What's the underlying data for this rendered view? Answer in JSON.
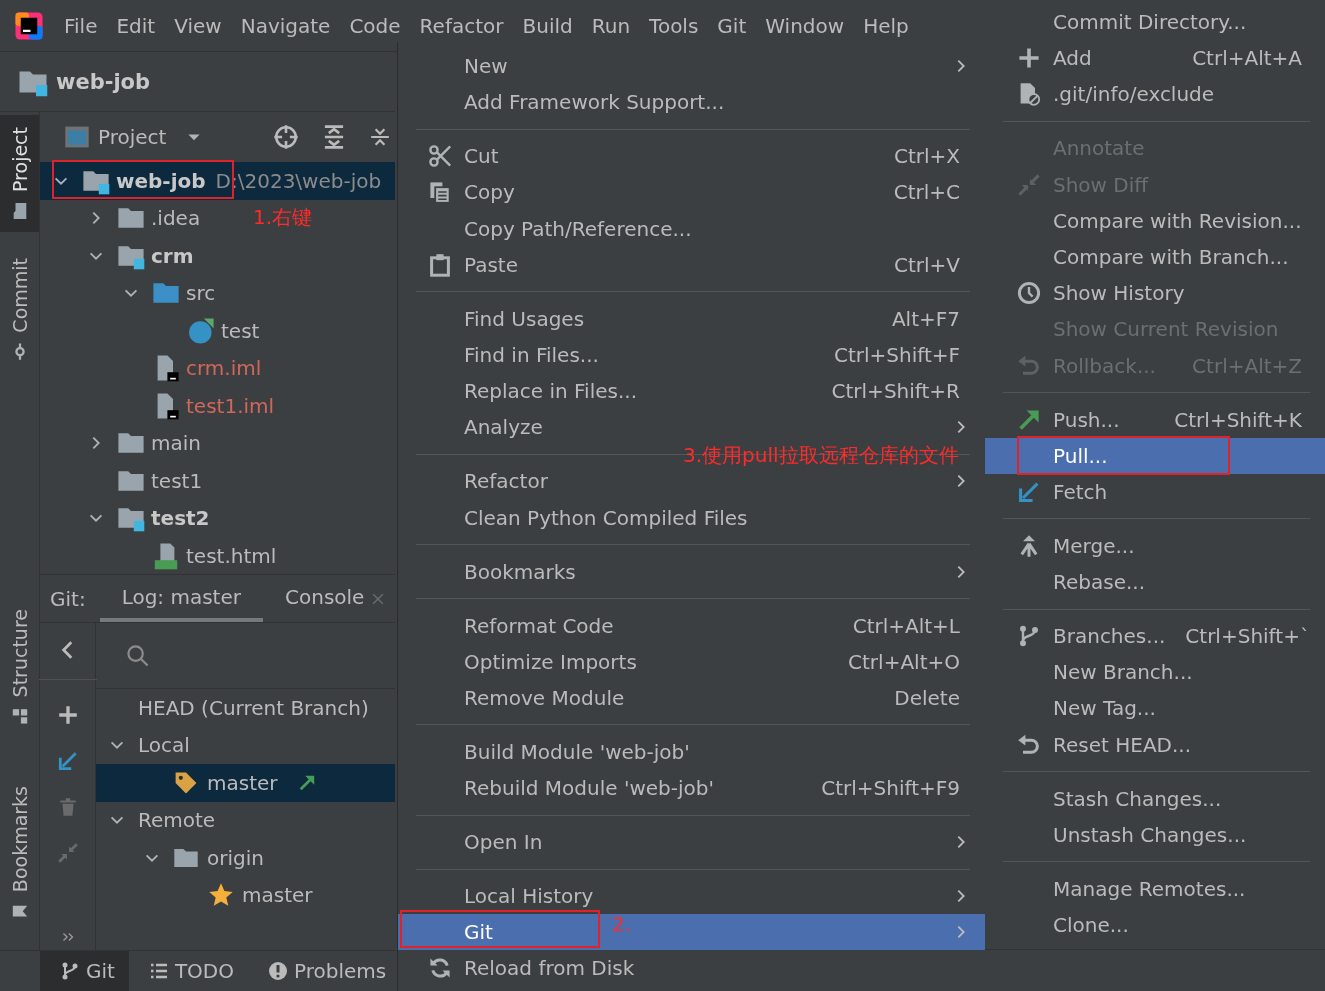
{
  "menubar": {
    "items": [
      "File",
      "Edit",
      "View",
      "Navigate",
      "Code",
      "Refactor",
      "Build",
      "Run",
      "Tools",
      "Git",
      "Window",
      "Help"
    ]
  },
  "navbar": {
    "project": "web-job"
  },
  "tool_strip": {
    "top": [
      {
        "label": "Project",
        "kind": "folder",
        "selected": true
      },
      {
        "label": "Commit",
        "kind": "commit",
        "selected": false
      }
    ],
    "bottom": [
      {
        "label": "Structure",
        "kind": "structure",
        "selected": false
      },
      {
        "label": "Bookmarks",
        "kind": "bookmark",
        "selected": false
      }
    ]
  },
  "project_panel": {
    "title": "Project",
    "tree": [
      {
        "label": "web-job",
        "path": "D:\\2023\\web-job",
        "kind": "module",
        "bold": true,
        "expanded": true,
        "selected": true,
        "children": [
          {
            "label": ".idea",
            "kind": "folder",
            "expanded": false,
            "selected": false
          },
          {
            "label": "crm",
            "kind": "module",
            "bold": true,
            "expanded": true,
            "selected": false,
            "children": [
              {
                "label": "src",
                "kind": "source",
                "expanded": true,
                "selected": false,
                "children": [
                  {
                    "label": "test",
                    "kind": "class",
                    "selected": false
                  }
                ]
              },
              {
                "label": "crm.iml",
                "kind": "iml",
                "color": "#d1675a",
                "selected": false
              },
              {
                "label": "test1.iml",
                "kind": "iml",
                "color": "#d1675a",
                "selected": false
              }
            ]
          },
          {
            "label": "main",
            "kind": "folder",
            "expanded": false,
            "selected": false
          },
          {
            "label": "test1",
            "kind": "folder",
            "selected": false
          },
          {
            "label": "test2",
            "kind": "module",
            "bold": true,
            "expanded": true,
            "selected": false,
            "children": [
              {
                "label": "test.html",
                "kind": "html",
                "selected": false
              }
            ]
          }
        ]
      }
    ]
  },
  "git_panel": {
    "label": "Git:",
    "tabs": [
      {
        "label": "Log: master",
        "selected": true
      },
      {
        "label": "Console",
        "selected": false,
        "closable": true
      }
    ],
    "toolbar": [
      {
        "kind": "back",
        "disabled": false
      },
      {
        "kind": "plus",
        "disabled": false
      },
      {
        "kind": "fetch",
        "disabled": false
      },
      {
        "kind": "trash",
        "disabled": true
      },
      {
        "kind": "compress",
        "disabled": true
      },
      {
        "kind": "more",
        "disabled": false
      }
    ],
    "branches": [
      {
        "label": "HEAD (Current Branch)",
        "selected": false
      },
      {
        "label": "Local",
        "expanded": true,
        "selected": false,
        "children": [
          {
            "label": "master",
            "kind": "tag",
            "outgoing": true,
            "selected": true
          }
        ]
      },
      {
        "label": "Remote",
        "expanded": true,
        "selected": false,
        "children": [
          {
            "label": "origin",
            "kind": "folder",
            "expanded": true,
            "selected": false,
            "children": [
              {
                "label": "master",
                "kind": "star",
                "selected": false
              }
            ]
          }
        ]
      }
    ]
  },
  "bottom_bar": {
    "tabs": [
      {
        "label": "Git",
        "kind": "branch",
        "selected": true
      },
      {
        "label": "TODO",
        "kind": "list",
        "selected": false
      },
      {
        "label": "Problems",
        "kind": "problems",
        "selected": false
      }
    ]
  },
  "context_menu": {
    "groups": [
      {
        "items": [
          {
            "label": "New",
            "submenu": true,
            "selected": false
          },
          {
            "label": "Add Framework Support...",
            "selected": false
          }
        ]
      },
      {
        "items": [
          {
            "label": "Cut",
            "shortcut": "Ctrl+X",
            "kind": "scissors",
            "selected": false
          },
          {
            "label": "Copy",
            "shortcut": "Ctrl+C",
            "kind": "copy",
            "selected": false
          },
          {
            "label": "Copy Path/Reference...",
            "selected": false
          },
          {
            "label": "Paste",
            "shortcut": "Ctrl+V",
            "kind": "clipboard",
            "selected": false
          }
        ]
      },
      {
        "items": [
          {
            "label": "Find Usages",
            "shortcut": "Alt+F7",
            "selected": false
          },
          {
            "label": "Find in Files...",
            "shortcut": "Ctrl+Shift+F",
            "selected": false
          },
          {
            "label": "Replace in Files...",
            "shortcut": "Ctrl+Shift+R",
            "selected": false
          },
          {
            "label": "Analyze",
            "submenu": true,
            "selected": false
          }
        ]
      },
      {
        "items": [
          {
            "label": "Refactor",
            "submenu": true,
            "selected": false
          },
          {
            "label": "Clean Python Compiled Files",
            "selected": false
          }
        ]
      },
      {
        "items": [
          {
            "label": "Bookmarks",
            "submenu": true,
            "selected": false
          }
        ]
      },
      {
        "items": [
          {
            "label": "Reformat Code",
            "shortcut": "Ctrl+Alt+L",
            "selected": false
          },
          {
            "label": "Optimize Imports",
            "shortcut": "Ctrl+Alt+O",
            "selected": false
          },
          {
            "label": "Remove Module",
            "shortcut": "Delete",
            "selected": false
          }
        ]
      },
      {
        "items": [
          {
            "label": "Build Module 'web-job'",
            "selected": false
          },
          {
            "label": "Rebuild Module 'web-job'",
            "shortcut": "Ctrl+Shift+F9",
            "selected": false
          }
        ]
      },
      {
        "items": [
          {
            "label": "Open In",
            "submenu": true,
            "selected": false
          }
        ]
      },
      {
        "items": [
          {
            "label": "Local History",
            "submenu": true,
            "selected": false
          },
          {
            "label": "Git",
            "submenu": true,
            "selected": true
          },
          {
            "label": "Reload from Disk",
            "kind": "reload",
            "selected": false
          }
        ]
      }
    ]
  },
  "git_submenu": {
    "groups": [
      {
        "items": [
          {
            "label": "Commit Directory...",
            "disabled": false,
            "selected": false
          },
          {
            "label": "Add",
            "shortcut": "Ctrl+Alt+A",
            "kind": "plus",
            "disabled": false,
            "selected": false
          },
          {
            "label": ".git/info/exclude",
            "kind": "ignore",
            "disabled": false,
            "selected": false
          }
        ]
      },
      {
        "items": [
          {
            "label": "Annotate",
            "disabled": true,
            "selected": false
          },
          {
            "label": "Show Diff",
            "kind": "diff",
            "disabled": true,
            "selected": false
          },
          {
            "label": "Compare with Revision...",
            "disabled": false,
            "selected": false
          },
          {
            "label": "Compare with Branch...",
            "disabled": false,
            "selected": false
          },
          {
            "label": "Show History",
            "kind": "clock",
            "disabled": false,
            "selected": false
          },
          {
            "label": "Show Current Revision",
            "disabled": true,
            "selected": false
          },
          {
            "label": "Rollback...",
            "shortcut": "Ctrl+Alt+Z",
            "kind": "undo",
            "disabled": true,
            "selected": false
          }
        ]
      },
      {
        "items": [
          {
            "label": "Push...",
            "shortcut": "Ctrl+Shift+K",
            "kind": "push",
            "disabled": false,
            "selected": false
          },
          {
            "label": "Pull...",
            "disabled": false,
            "selected": true
          },
          {
            "label": "Fetch",
            "kind": "fetch",
            "disabled": false,
            "selected": false
          }
        ]
      },
      {
        "items": [
          {
            "label": "Merge...",
            "kind": "merge",
            "disabled": false,
            "selected": false
          },
          {
            "label": "Rebase...",
            "disabled": false,
            "selected": false
          }
        ]
      },
      {
        "items": [
          {
            "label": "Branches...",
            "shortcut": "Ctrl+Shift+`",
            "kind": "branch",
            "disabled": false,
            "selected": false
          },
          {
            "label": "New Branch...",
            "disabled": false,
            "selected": false
          },
          {
            "label": "New Tag...",
            "disabled": false,
            "selected": false
          },
          {
            "label": "Reset HEAD...",
            "kind": "undo",
            "disabled": false,
            "selected": false
          }
        ]
      },
      {
        "items": [
          {
            "label": "Stash Changes...",
            "disabled": false,
            "selected": false
          },
          {
            "label": "Unstash Changes...",
            "disabled": false,
            "selected": false
          }
        ]
      },
      {
        "items": [
          {
            "label": "Manage Remotes...",
            "disabled": false,
            "selected": false
          },
          {
            "label": "Clone...",
            "disabled": false,
            "selected": false
          }
        ]
      }
    ]
  },
  "annotations": [
    {
      "kind": "box"
    },
    {
      "kind": "note",
      "text": "1.右键"
    },
    {
      "kind": "box"
    },
    {
      "kind": "note",
      "text": "2."
    },
    {
      "kind": "box"
    },
    {
      "kind": "note",
      "text": "3.使用pull拉取远程仓库的文件"
    }
  ]
}
